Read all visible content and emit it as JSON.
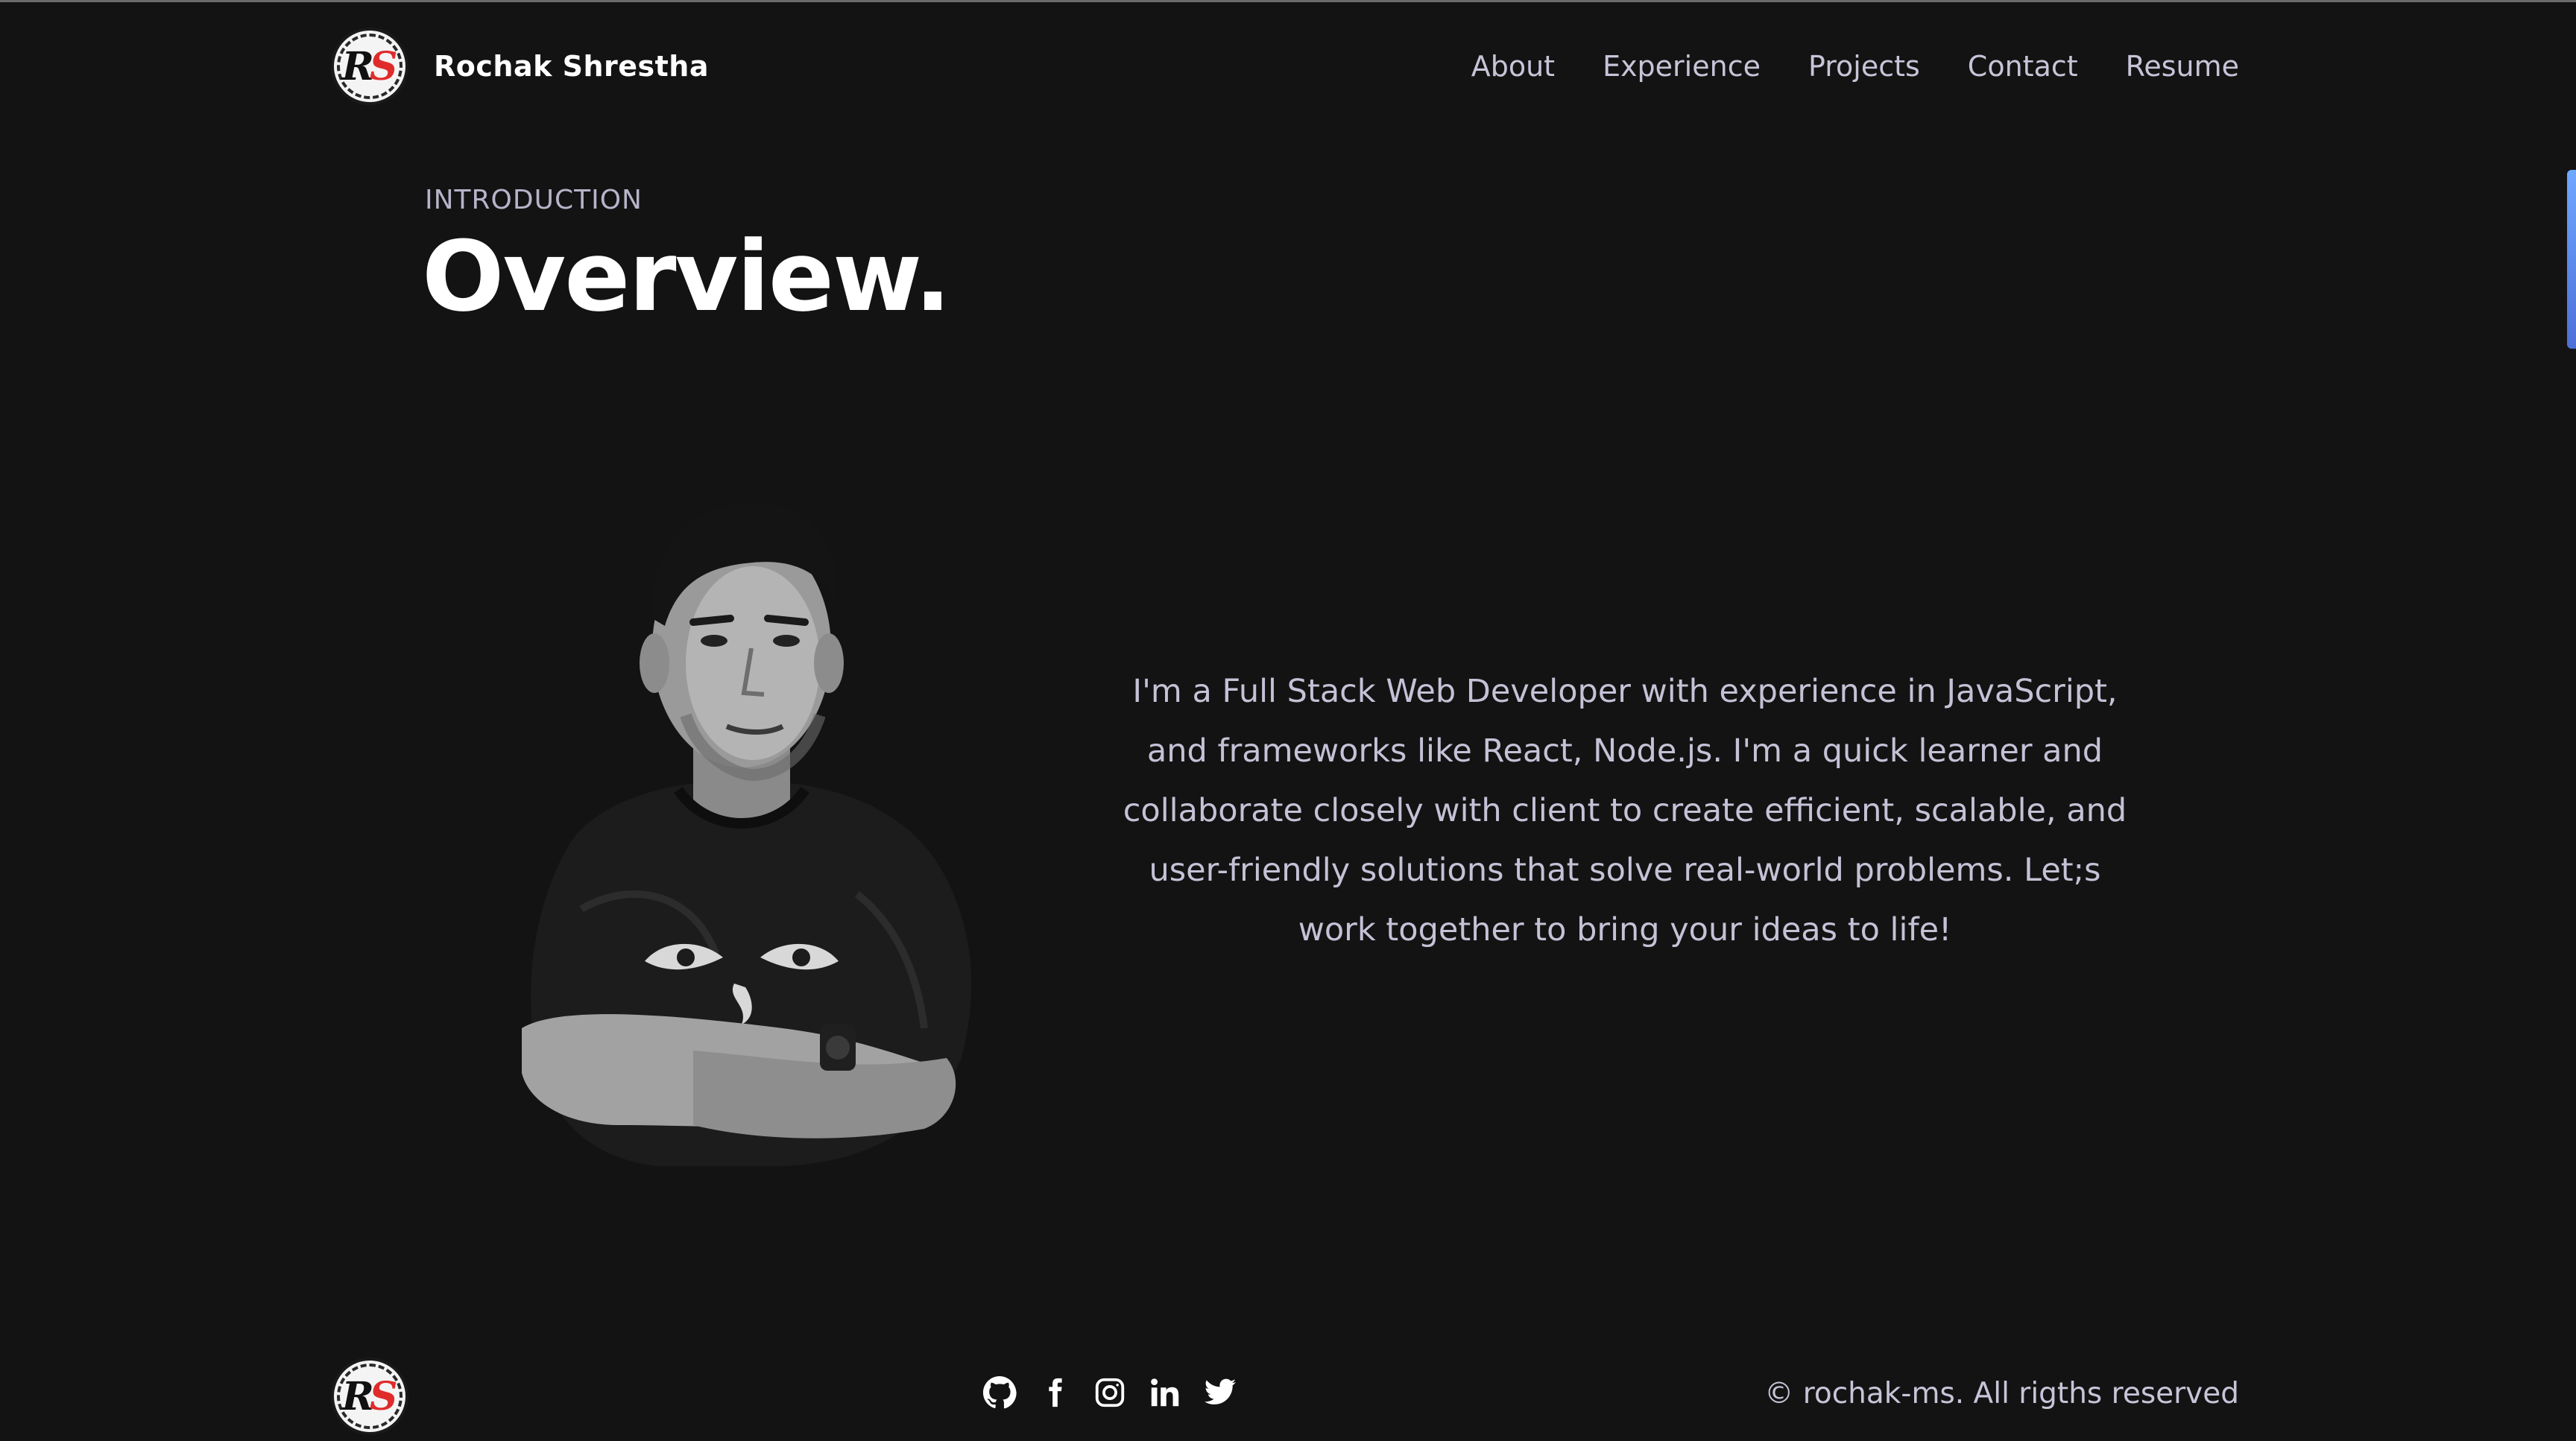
{
  "brand": {
    "logo_initial_1": "R",
    "logo_initial_2": "S",
    "name": "Rochak Shrestha"
  },
  "nav": {
    "items": [
      {
        "label": "About"
      },
      {
        "label": "Experience"
      },
      {
        "label": "Projects"
      },
      {
        "label": "Contact"
      },
      {
        "label": "Resume"
      }
    ]
  },
  "overview": {
    "subtitle": "INTRODUCTION",
    "title": "Overview.",
    "description": "I'm a Full Stack Web Developer with experience in JavaScript, and frameworks like React, Node.js. I'm a quick learner and collaborate closely with client to create efficient, scalable, and user-friendly solutions that solve real-world problems. Let;s work together to bring your ideas to life!"
  },
  "footer": {
    "socials": [
      {
        "icon": "github-icon"
      },
      {
        "icon": "facebook-icon"
      },
      {
        "icon": "instagram-icon"
      },
      {
        "icon": "linkedin-icon"
      },
      {
        "icon": "twitter-icon"
      }
    ],
    "copyright": "© rochak-ms. All rigths reserved"
  },
  "colors": {
    "background": "#131313",
    "accent_red": "#e02b2b",
    "nav_text": "#c8c4d8",
    "scroll_indicator": "#6ea8ff"
  }
}
